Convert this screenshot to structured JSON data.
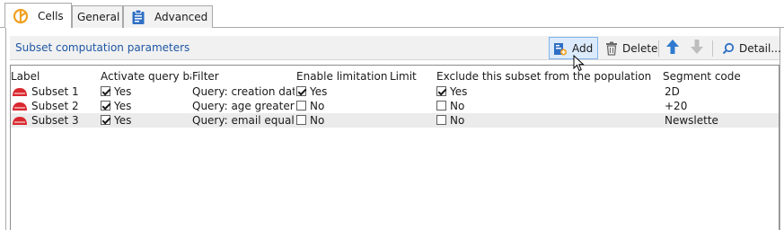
{
  "tabs": [
    {
      "label": "Cells",
      "active": true,
      "icon": "segment-chart-icon"
    },
    {
      "label": "General",
      "active": false
    },
    {
      "label": "Advanced",
      "active": false,
      "icon": "clipboard-icon"
    }
  ],
  "toolbar": {
    "title": "Subset computation parameters",
    "add_label": "Add",
    "delete_label": "Delete",
    "detail_label": "Detail..."
  },
  "grid": {
    "columns": [
      "Label",
      "Activate query bas..",
      "Filter",
      "Enable limitation",
      "Limit",
      "Exclude this subset from the population",
      "Segment code"
    ],
    "rows": [
      {
        "label": "Subset 1",
        "activate": "Yes",
        "activate_checked": true,
        "filter": "Query: creation dat...",
        "limitation": "Yes",
        "limitation_checked": true,
        "limit": "",
        "exclude": "Yes",
        "exclude_checked": true,
        "code": "2D"
      },
      {
        "label": "Subset 2",
        "activate": "Yes",
        "activate_checked": true,
        "filter": "Query: age greater th..",
        "limitation": "No",
        "limitation_checked": false,
        "limit": "",
        "exclude": "No",
        "exclude_checked": false,
        "code": "+20"
      },
      {
        "label": "Subset 3",
        "activate": "Yes",
        "activate_checked": true,
        "filter": "Query: email equal t...",
        "limitation": "No",
        "limitation_checked": false,
        "limit": "",
        "exclude": "No",
        "exclude_checked": false,
        "code": "Newslette"
      }
    ]
  },
  "colors": {
    "accent": "#1f57a4",
    "tab_icon": "#f0a020",
    "segment_icon": "#d9282f"
  }
}
